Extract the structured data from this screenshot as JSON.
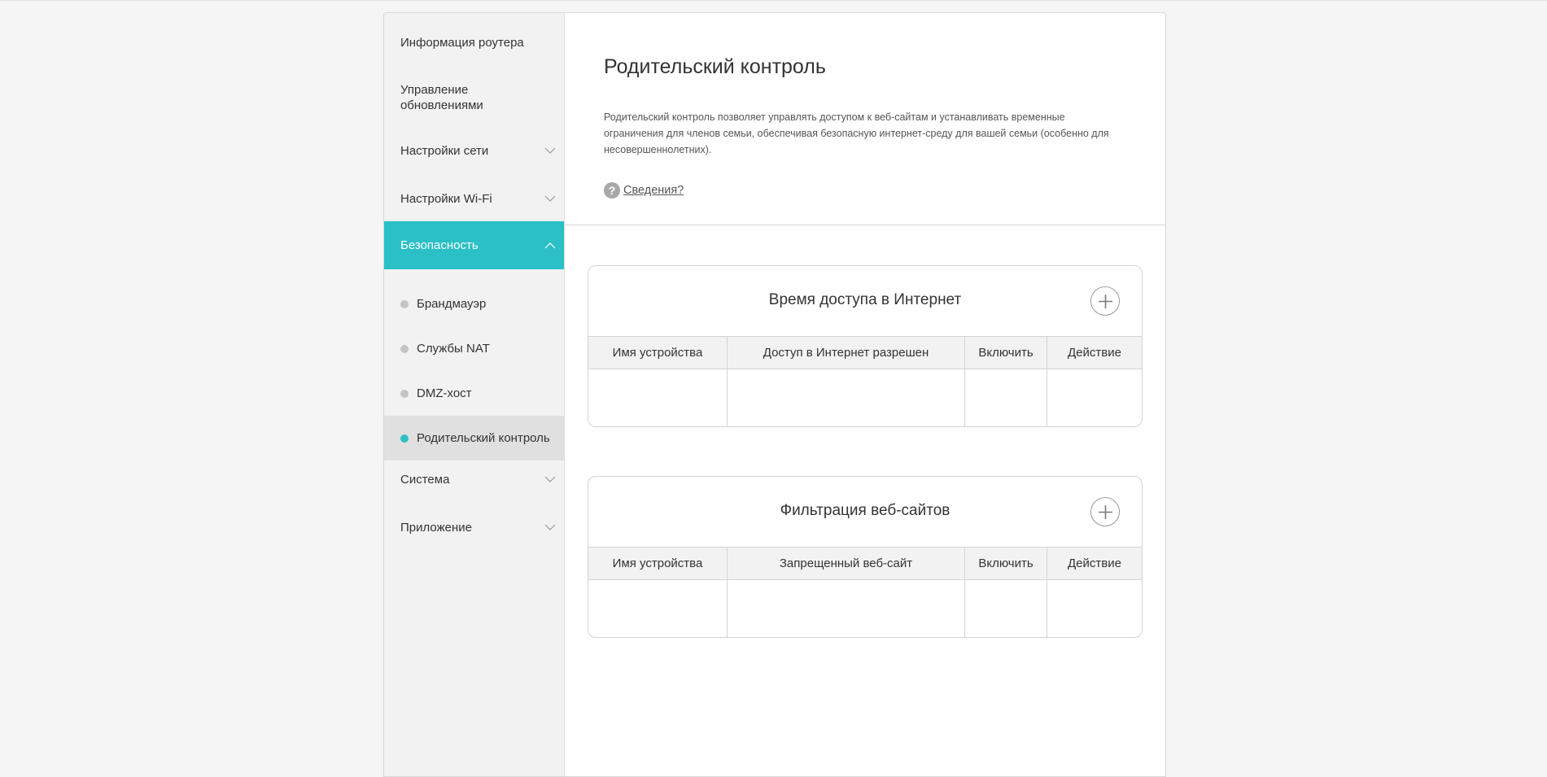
{
  "sidebar": {
    "items": [
      {
        "label": "Информация роутера",
        "has_chevron": false
      },
      {
        "label": "Управление обновлениями",
        "has_chevron": false
      },
      {
        "label": "Настройки сети",
        "has_chevron": true
      },
      {
        "label": "Настройки Wi-Fi",
        "has_chevron": true
      },
      {
        "label": "Безопасность",
        "has_chevron": true,
        "expanded": true,
        "active": true
      },
      {
        "label": "Система",
        "has_chevron": true
      },
      {
        "label": "Приложение",
        "has_chevron": true
      }
    ],
    "security_subitems": [
      {
        "label": "Брандмауэр"
      },
      {
        "label": "Службы NAT"
      },
      {
        "label": "DMZ-хост"
      },
      {
        "label": "Родительский контроль",
        "current": true
      }
    ]
  },
  "main": {
    "title": "Родительский контроль",
    "description": "Родительский контроль позволяет управлять доступом к веб-сайтам и устанавливать временные ограничения для членов семьи, обеспечивая безопасную интернет-среду для вашей семьи (особенно для несовершеннолетних).",
    "help_label": "Сведения?",
    "help_icon": "?"
  },
  "panels": {
    "internet_time": {
      "title": "Время доступа в Интернет",
      "columns": [
        "Имя устройства",
        "Доступ в Интернет разрешен",
        "Включить",
        "Действие"
      ],
      "rows": []
    },
    "web_filter": {
      "title": "Фильтрация веб-сайтов",
      "columns": [
        "Имя устройства",
        "Запрещенный веб-сайт",
        "Включить",
        "Действие"
      ],
      "rows": []
    }
  },
  "colors": {
    "accent": "#2bbfc6",
    "sidebar_bg": "#f2f2f2",
    "selected_bg": "#e0e0e0"
  }
}
